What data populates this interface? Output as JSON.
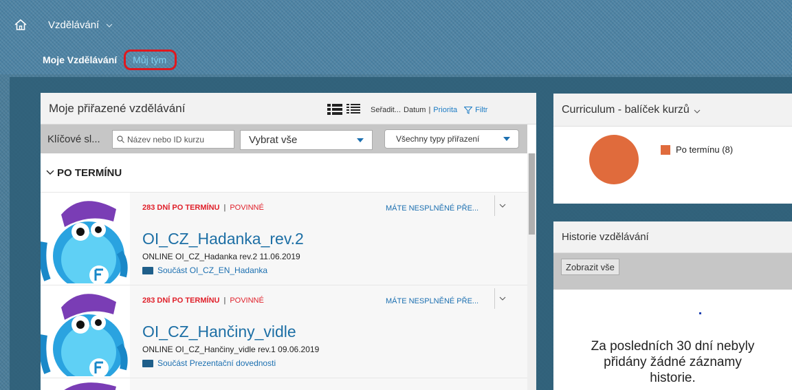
{
  "shell": {
    "app_title": "Vzdělávání",
    "tabs": [
      {
        "label": "Moje Vzdělávání"
      },
      {
        "label": "Můj tým"
      }
    ]
  },
  "assigned": {
    "title": "Moje přiřazené vzdělávání",
    "sort_label": "Seřadit...",
    "sort_date": "Datum",
    "sort_sep": "|",
    "sort_priority": "Priorita",
    "filter": "Filtr",
    "keyword_label": "Klíčové sl...",
    "search_placeholder": "Název nebo ID kurzu",
    "select_all": "Vybrat vše",
    "assignment_types": "Všechny typy přiřazení",
    "group_header": "PO TERMÍNU",
    "courses": [
      {
        "due": "283 DNÍ PO TERMÍNU",
        "sep": "|",
        "required": "POVINNÉ",
        "warning": "MÁTE NESPLNĚNÉ PŘE...",
        "title": "OI_CZ_Hadanka_rev.2",
        "meta": "ONLINE OI_CZ_Hadanka rev.2 11.06.2019",
        "part": "Součást OI_CZ_EN_Hadanka"
      },
      {
        "due": "283 DNÍ PO TERMÍNU",
        "sep": "|",
        "required": "POVINNÉ",
        "warning": "MÁTE NESPLNĚNÉ PŘE...",
        "title": "OI_CZ_Hančiny_vidle",
        "meta": "ONLINE OI_CZ_Hančiny_vidle rev.1 09.06.2019",
        "part": "Součást Prezentační dovednosti"
      }
    ]
  },
  "curriculum": {
    "title": "Curriculum - balíček kurzů",
    "legend": "Po termínu (8)",
    "color": "#e06b3c"
  },
  "history": {
    "title": "Historie vzdělávání",
    "show_all": "Zobrazit vše",
    "empty_line1": "Za posledních 30 dní nebyly",
    "empty_line2": "přidány žádné záznamy",
    "empty_line3": "historie."
  }
}
